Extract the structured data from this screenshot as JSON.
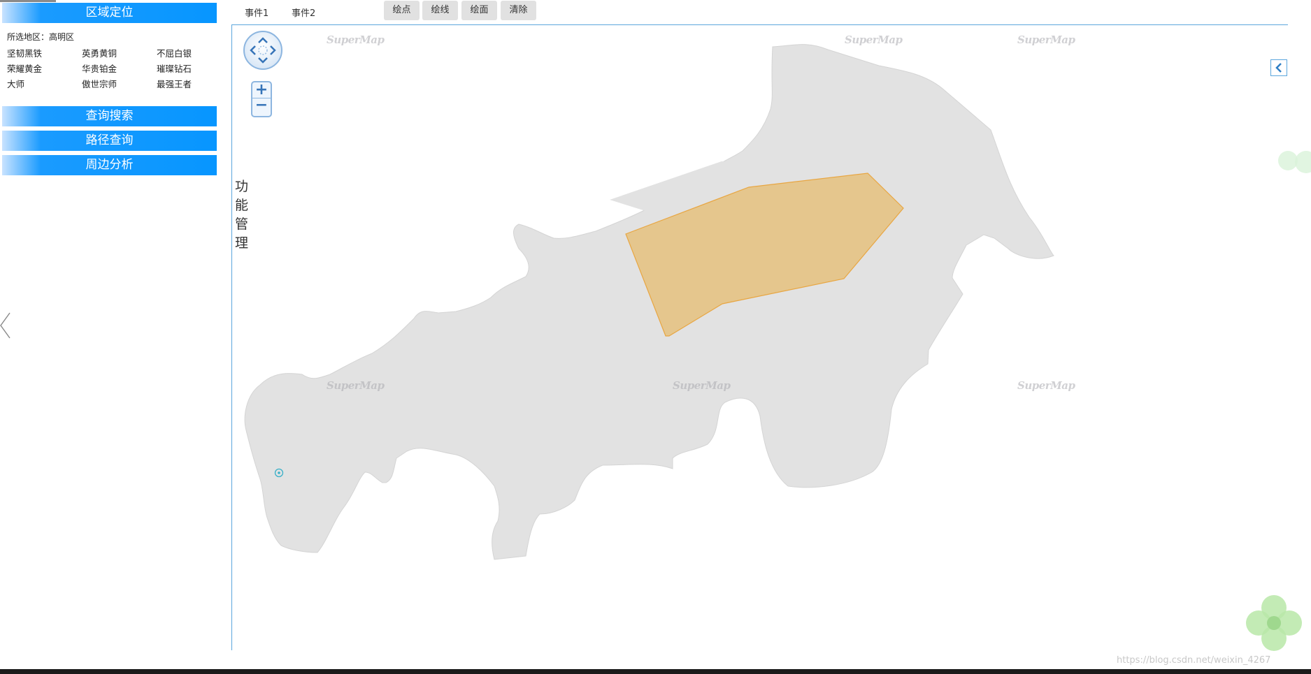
{
  "sidebar": {
    "region_header": "区域定位",
    "selected_prefix": "所选地区：",
    "selected_value": "高明区",
    "ranks": [
      "坚韧黑铁",
      "英勇黄铜",
      "不屈白银",
      "荣耀黄金",
      "华贵铂金",
      "璀璨钻石",
      "大师",
      "傲世宗师",
      "最强王者"
    ],
    "query_header": "查询搜索",
    "route_header": "路径查询",
    "nearby_header": "周边分析"
  },
  "toolbar": {
    "event1": "事件1",
    "event2": "事件2",
    "draw_point": "绘点",
    "draw_line": "绘线",
    "draw_polygon": "绘面",
    "clear": "清除"
  },
  "map": {
    "function_label": [
      "功",
      "能",
      "管",
      "理"
    ],
    "watermark": "SuperMap",
    "land_color": "#e2e2e2",
    "polygon_fill": "#e5c488",
    "polygon_stroke": "#e8a642",
    "nav_icon": "pan-compass-icon",
    "zoom_in": "+",
    "zoom_out": "−"
  },
  "footer": {
    "url": "https://blog.csdn.net/weixin_4267"
  },
  "colors": {
    "accent_blue": "#0796ff",
    "map_border": "#5ba6dd"
  }
}
